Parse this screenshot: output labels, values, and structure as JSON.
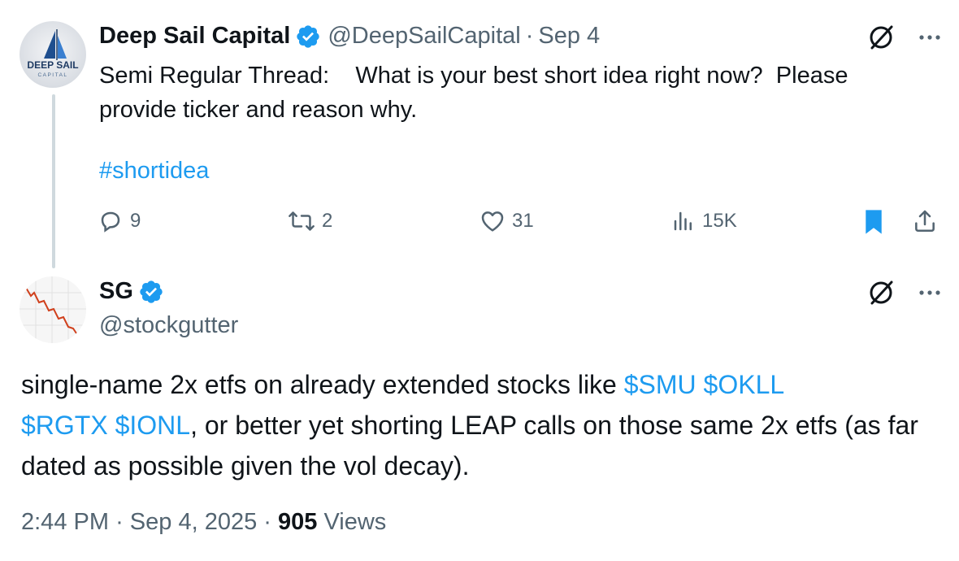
{
  "tweet1": {
    "avatar_text": "DEEP SAIL",
    "avatar_subtext": "CAPITAL",
    "display_name": "Deep Sail Capital",
    "handle": "@DeepSailCapital",
    "separator": "·",
    "date": "Sep 4",
    "text": "Semi Regular Thread:    What is your best short idea right now?  Please provide ticker and reason why.",
    "hashtag": "#shortidea",
    "actions": {
      "replies": "9",
      "retweets": "2",
      "likes": "31",
      "views": "15K"
    },
    "icons": [
      "grok-icon",
      "more-icon",
      "reply-icon",
      "retweet-icon",
      "like-icon",
      "views-icon",
      "bookmark-icon",
      "share-icon"
    ]
  },
  "tweet2": {
    "display_name": "SG",
    "handle": "@stockgutter",
    "text_prefix": "single-name 2x etfs on already extended stocks like ",
    "tickers_1": "$SMU $OKLL",
    "tickers_2": "$RGTX $IONL",
    "text_suffix": ", or better yet shorting LEAP calls on those same 2x etfs (as far dated as possible given the vol decay).",
    "time": "2:44 PM",
    "separator": "·",
    "full_date": "Sep 4, 2025",
    "views_count": "905",
    "views_label": "Views"
  },
  "colors": {
    "link": "#1d9bf0",
    "secondary": "#536471",
    "primary_text": "#0f1419",
    "thread_line": "#cfd9de"
  }
}
